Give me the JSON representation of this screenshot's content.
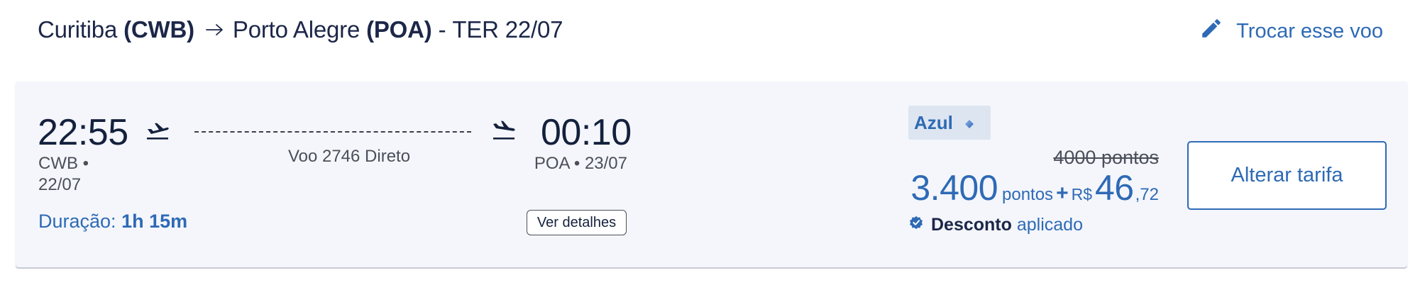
{
  "header": {
    "origin_city": "Curitiba",
    "origin_code": "(CWB)",
    "destination_city": "Porto Alegre",
    "destination_code": "(POA)",
    "separator": "-",
    "date": "TER 22/07",
    "change_flight_label": "Trocar esse voo"
  },
  "flight": {
    "departure_time": "22:55",
    "arrival_time": "00:10",
    "departure_code": "CWB •",
    "departure_date": "22/07",
    "arrival_info": "POA • 23/07",
    "flight_info": "Voo 2746 Direto",
    "duration_label": "Duração:",
    "duration_value": "1h 15m",
    "details_button": "Ver detalhes"
  },
  "fare": {
    "airline": "Azul",
    "old_price": "4000 pontos",
    "points": "3.400",
    "points_unit": "pontos",
    "plus": "+",
    "currency": "R$",
    "cash_integer": "46",
    "cash_cents": ",72",
    "discount_label": "Desconto",
    "discount_suffix": "aplicado",
    "change_fare_button": "Alterar tarifa"
  },
  "colors": {
    "accent": "#2e6ab5",
    "text_dark": "#14213d",
    "card_bg": "#f4f6fb"
  },
  "icons": [
    "arrow-right-icon",
    "pencil-icon",
    "takeoff-icon",
    "landing-icon",
    "diamond-icon",
    "verified-badge-icon"
  ]
}
